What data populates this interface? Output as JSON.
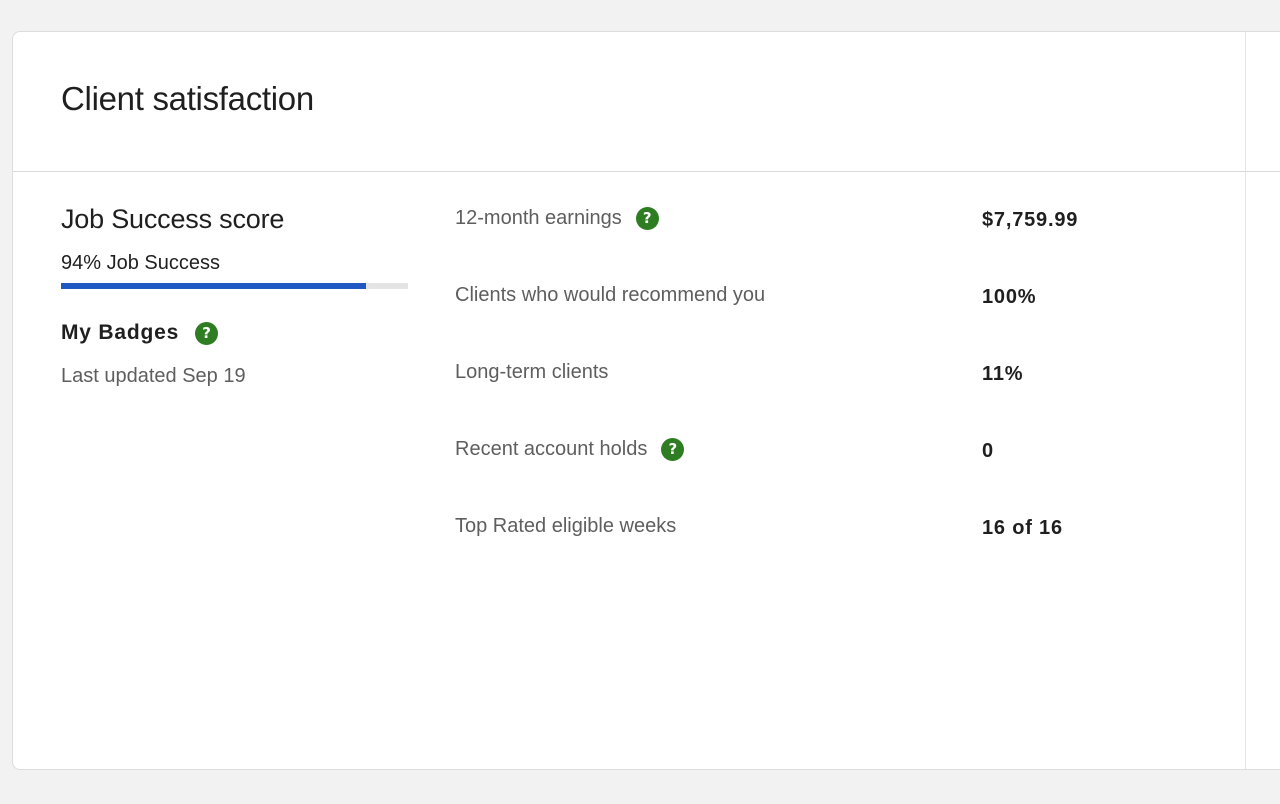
{
  "card": {
    "title": "Client satisfaction"
  },
  "job_success": {
    "title": "Job Success score",
    "value_label": "94% Job Success",
    "percent": 88,
    "bar_color": "#1f57c3"
  },
  "badges": {
    "title": "My Badges",
    "help_icon": "question-mark-icon",
    "updated": "Last updated Sep 19"
  },
  "stats": [
    {
      "label": "12-month earnings",
      "value": "$7,759.99",
      "help": true
    },
    {
      "label": "Clients who would recommend you",
      "value": "100%",
      "help": false
    },
    {
      "label": "Long-term clients",
      "value": "11%",
      "help": false
    },
    {
      "label": "Recent account holds",
      "value": "0",
      "help": true
    },
    {
      "label": "Top Rated eligible weeks",
      "value": "16 of 16",
      "help": false
    }
  ],
  "colors": {
    "help_icon": "#2e7d22",
    "accent": "#1f57c3"
  },
  "help_glyph": "?"
}
